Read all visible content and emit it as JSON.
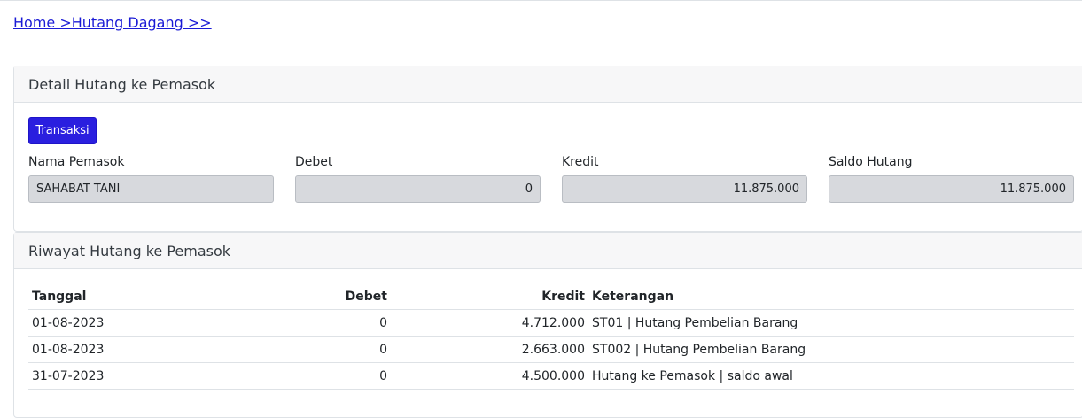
{
  "breadcrumb": "Home >Hutang Dagang >>",
  "detail": {
    "title": "Detail Hutang ke Pemasok",
    "button": "Transaksi",
    "fields": {
      "nama": {
        "label": "Nama Pemasok",
        "value": "SAHABAT TANI"
      },
      "debet": {
        "label": "Debet",
        "value": "0"
      },
      "kredit": {
        "label": "Kredit",
        "value": "11.875.000"
      },
      "saldo": {
        "label": "Saldo Hutang",
        "value": "11.875.000"
      }
    }
  },
  "history": {
    "title": "Riwayat Hutang ke Pemasok",
    "columns": [
      "Tanggal",
      "Debet",
      "Kredit",
      "Keterangan"
    ],
    "rows": [
      [
        "01-08-2023",
        "0",
        "4.712.000",
        "ST01 | Hutang Pembelian Barang"
      ],
      [
        "01-08-2023",
        "0",
        "2.663.000",
        "ST002 | Hutang Pembelian Barang"
      ],
      [
        "31-07-2023",
        "0",
        "4.500.000",
        "Hutang ke Pemasok | saldo awal"
      ]
    ]
  }
}
